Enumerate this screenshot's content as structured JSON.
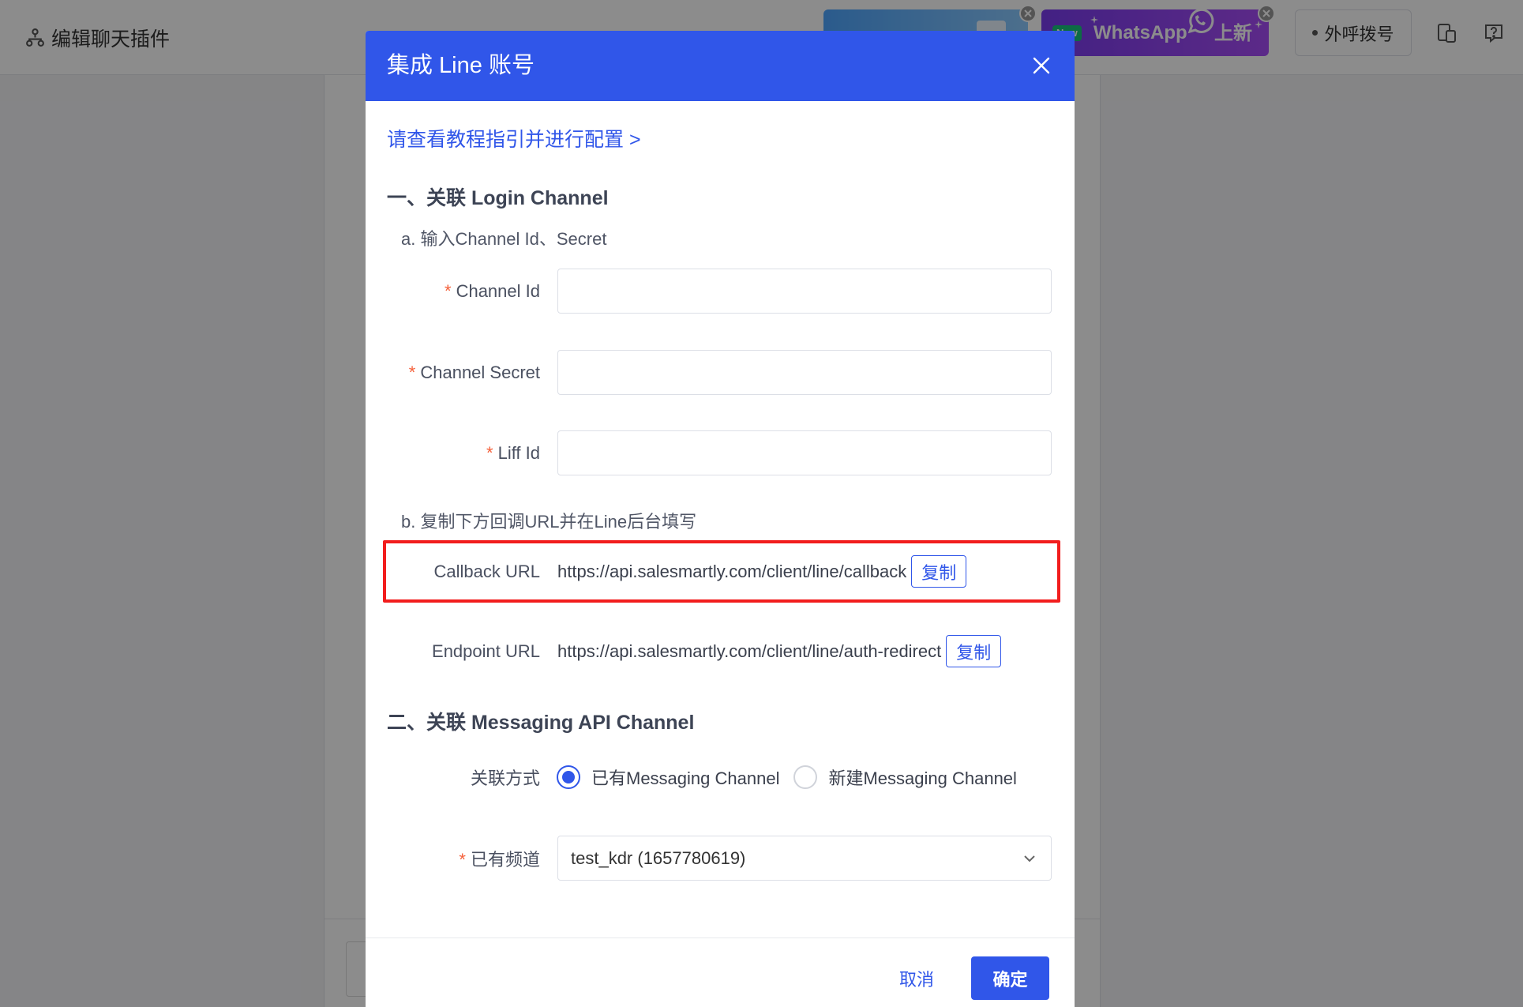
{
  "colors": {
    "primary": "#3056e9",
    "highlight_red": "#f21d1d",
    "required_mark": "#f5603a",
    "whatsapp_banner": "#8d44f5",
    "new_badge": "#19c37d"
  },
  "topbar": {
    "title": "编辑聊天插件",
    "title_icon": "sitemap-icon",
    "whatsapp_promo": {
      "badge": "New",
      "brand": "WhatsApp",
      "tag": "上新",
      "icon": "whatsapp-icon"
    },
    "dial_button": "外呼拨号",
    "device_icon": "devices-icon",
    "help_icon": "help-icon"
  },
  "modal": {
    "title": "集成 Line 账号",
    "close_icon": "close-icon",
    "required_mark": "*",
    "tutorial_link": "请查看教程指引并进行配置 >",
    "section_login": {
      "heading": "一、关联 Login Channel",
      "step_a": "a. 输入Channel Id、Secret",
      "fields": [
        {
          "label": "Channel Id",
          "required": true,
          "value": ""
        },
        {
          "label": "Channel Secret",
          "required": true,
          "value": ""
        },
        {
          "label": "Liff Id",
          "required": true,
          "value": ""
        }
      ],
      "step_b": "b. 复制下方回调URL并在Line后台填写",
      "urls": [
        {
          "label": "Callback URL",
          "value": "https://api.salesmartly.com/client/line/callback",
          "copy_label": "复制",
          "highlighted": true
        },
        {
          "label": "Endpoint URL",
          "value": "https://api.salesmartly.com/client/line/auth-redirect",
          "copy_label": "复制",
          "highlighted": false
        }
      ]
    },
    "section_messaging": {
      "heading": "二、关联 Messaging API Channel",
      "link_method": {
        "label": "关联方式",
        "options": [
          "已有Messaging Channel",
          "新建Messaging Channel"
        ],
        "selected": 0
      },
      "existing_channel": {
        "label": "已有频道",
        "required": true,
        "value": "test_kdr (1657780619)",
        "icon": "chevron-down-icon"
      }
    },
    "footer": {
      "cancel_label": "取消",
      "confirm_label": "确定"
    }
  }
}
